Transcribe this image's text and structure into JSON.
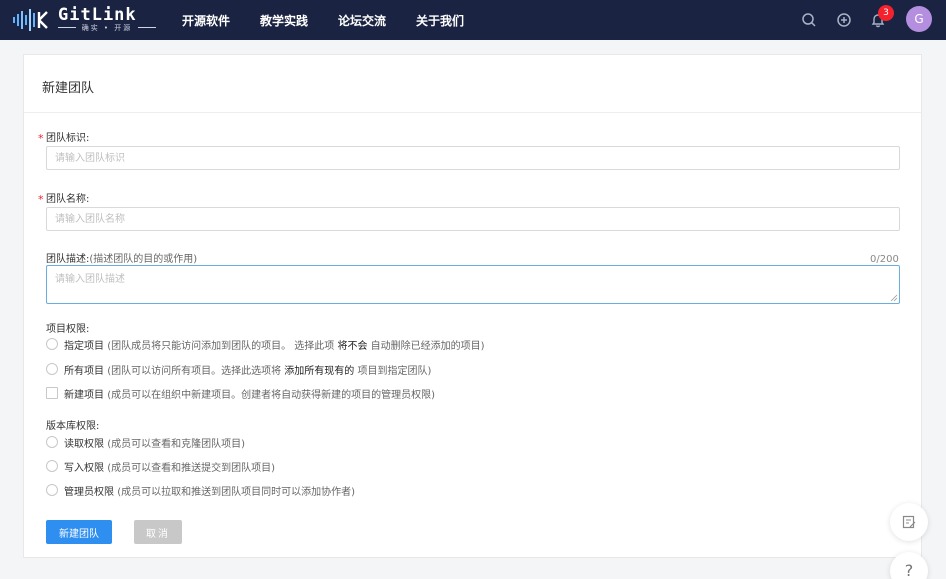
{
  "header": {
    "logo_text": "GitLink",
    "logo_tagline": "确实 • 开源",
    "nav": [
      "开源软件",
      "教学实践",
      "论坛交流",
      "关于我们"
    ],
    "notification_count": "3",
    "avatar_initial": "G",
    "icons": [
      "search-icon",
      "plus-circle-icon",
      "bell-icon"
    ]
  },
  "form": {
    "title": "新建团队",
    "identifier": {
      "label": "团队标识:",
      "placeholder": "请输入团队标识",
      "required_mark": "*"
    },
    "name": {
      "label": "团队名称:",
      "placeholder": "请输入团队名称",
      "required_mark": "*"
    },
    "description": {
      "label": "团队描述:",
      "hint": "(描述团队的目的或作用)",
      "placeholder": "请输入团队描述",
      "counter": "0/200"
    },
    "project_permission": {
      "label": "项目权限:",
      "options": [
        {
          "name": "指定项目",
          "desc_pre": "(团队成员将只能访问添加到团队的项目。 选择此项 ",
          "strong": "将不会",
          "desc_post": " 自动删除已经添加的项目)"
        },
        {
          "name": "所有项目",
          "desc_pre": "(团队可以访问所有项目。选择此选项将 ",
          "strong": "添加所有现有的",
          "desc_post": " 项目到指定团队)"
        },
        {
          "name": "新建项目",
          "desc_pre": "(成员可以在组织中新建项目。创建者将自动获得新建的项目的管理员权限)",
          "strong": "",
          "desc_post": ""
        }
      ]
    },
    "repo_permission": {
      "label": "版本库权限:",
      "options": [
        {
          "name": "读取权限",
          "desc": "(成员可以查看和克隆团队项目)"
        },
        {
          "name": "写入权限",
          "desc": "(成员可以查看和推送提交到团队项目)"
        },
        {
          "name": "管理员权限",
          "desc": "(成员可以拉取和推送到团队项目同时可以添加协作者)"
        }
      ]
    },
    "submit_label": "新建团队",
    "cancel_label": "取消"
  },
  "floating": {
    "feedback_icon": "edit-note-icon",
    "help_label": "?"
  },
  "colors": {
    "header_bg": "#1b2342",
    "primary": "#2f8ff0",
    "cancel": "#c8c8c8",
    "badge": "#f5222d",
    "avatar": "#b48fe0"
  }
}
